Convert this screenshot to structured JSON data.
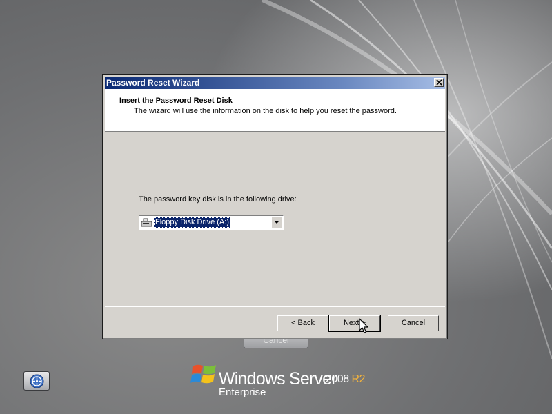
{
  "dialog": {
    "title": "Password Reset Wizard",
    "header_title": "Insert the Password Reset Disk",
    "header_subtitle": "The wizard will use the information on the disk to help you reset the password.",
    "drive_label": "The password key disk is in the following drive:",
    "drive_selected": "Floppy Disk Drive (A:)",
    "drive_icon": "floppy-drive-icon",
    "back_label": "< Back",
    "next_label": "Next >",
    "cancel_label": "Cancel"
  },
  "background": {
    "cancel_label": "Cancel"
  },
  "branding": {
    "product": "Windows Server",
    "version": "2008",
    "release": "R2",
    "edition": "Enterprise"
  },
  "colors": {
    "title_bar": "#0b2a74",
    "selection": "#0a246a",
    "dialog_face": "#d6d3ce",
    "r2_accent": "#f2b33d"
  }
}
